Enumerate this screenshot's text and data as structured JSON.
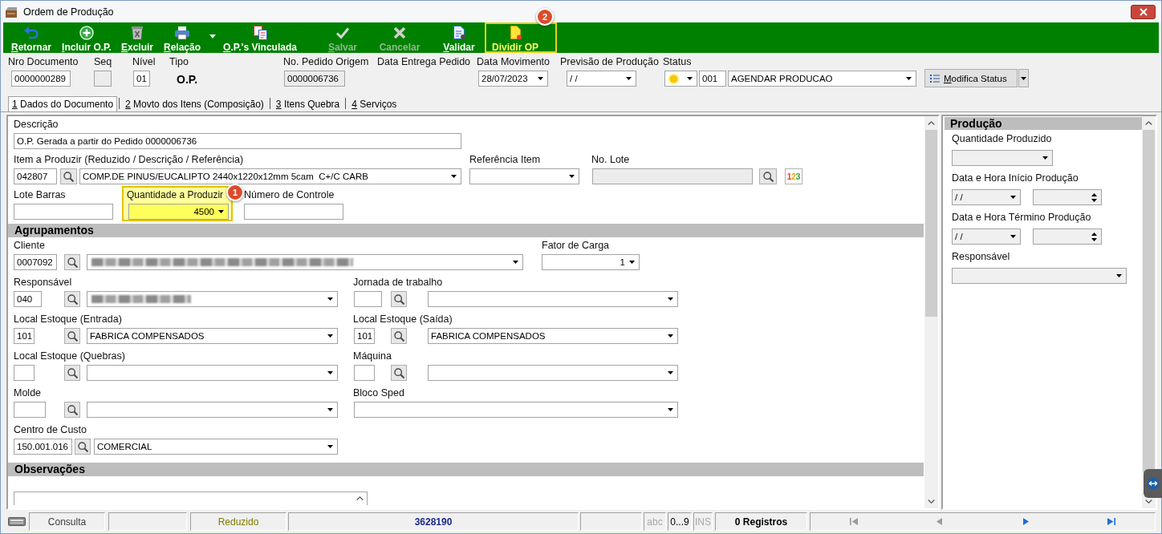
{
  "window": {
    "title": "Ordem de Produção"
  },
  "toolbar": [
    {
      "kind": "button",
      "label": "Retornar",
      "mnemonic": true,
      "disabled": false,
      "highlighted": false
    },
    {
      "kind": "button",
      "label": "Incluir O.P.",
      "mnemonic": true,
      "disabled": false,
      "highlighted": false
    },
    {
      "kind": "button",
      "label": "Excluir",
      "mnemonic": true,
      "disabled": false,
      "highlighted": false
    },
    {
      "kind": "button",
      "label": "Relação",
      "mnemonic": true,
      "disabled": false,
      "highlighted": false
    },
    {
      "kind": "caret",
      "disabled": false,
      "highlighted": false
    },
    {
      "kind": "button",
      "label": "O.P.'s Vinculada",
      "mnemonic": true,
      "disabled": false,
      "highlighted": false
    },
    {
      "kind": "button",
      "label": "Salvar",
      "mnemonic": true,
      "disabled": true,
      "highlighted": false
    },
    {
      "kind": "button",
      "label": "Cancelar",
      "mnemonic": false,
      "disabled": true,
      "highlighted": false
    },
    {
      "kind": "button",
      "label": "Validar",
      "mnemonic": true,
      "disabled": false,
      "highlighted": false
    },
    {
      "kind": "button",
      "label": "Dividir OP",
      "mnemonic": false,
      "disabled": false,
      "highlighted": true,
      "badge": "2"
    }
  ],
  "header": {
    "fields": [
      {
        "label": "Nro Documento",
        "controls": [
          {
            "kind": "field",
            "value": "0000000289"
          }
        ]
      },
      {
        "label": "Seq",
        "controls": [
          {
            "kind": "locked-field"
          }
        ]
      },
      {
        "label": "Nível",
        "controls": [
          {
            "kind": "field",
            "value": "01"
          }
        ]
      },
      {
        "label": "Tipo",
        "controls": [
          {
            "kind": "display",
            "value": "O.P."
          }
        ]
      },
      {
        "label": "No. Pedido Origem",
        "controls": [
          {
            "kind": "locked-field",
            "value": "0000006736"
          }
        ]
      },
      {
        "label": "Data Entrega Pedido"
      },
      {
        "label": "Data Movimento",
        "controls": [
          {
            "kind": "combo",
            "value": "28/07/2023"
          }
        ]
      },
      {
        "label": "Previsão de Produção",
        "controls": [
          {
            "kind": "combo",
            "value": "/ /"
          }
        ]
      },
      {
        "label": "Status",
        "controls": [
          {
            "kind": "color-picker"
          },
          {
            "kind": "field",
            "value": "001"
          },
          {
            "kind": "combo",
            "value": "AGENDAR PRODUCAO"
          },
          {
            "kind": "action",
            "label": "Modifica Status",
            "mnemonic": true
          },
          {
            "kind": "caret-button"
          }
        ]
      }
    ]
  },
  "tabs": [
    {
      "label": "1 Dados do Documento",
      "selected": true,
      "mnemonic": true
    },
    {
      "label": "2 Movto dos Itens (Composição)",
      "selected": false,
      "mnemonic": true
    },
    {
      "label": "3 Itens Quebra",
      "selected": false,
      "mnemonic": true
    },
    {
      "label": "4 Serviços",
      "selected": false,
      "mnemonic": true
    }
  ],
  "form": {
    "sections": [
      {
        "fields": [
          {
            "label": "Descrição",
            "highlighted": false,
            "controls": [
              {
                "kind": "field",
                "value": "O.P. Gerada a partir do Pedido 0000006736"
              }
            ]
          },
          {
            "label": "Item a Produzir (Reduzido / Descrição / Referência)",
            "highlighted": false,
            "controls": [
              {
                "kind": "field",
                "value": "042807"
              },
              {
                "kind": "search"
              },
              {
                "kind": "combo",
                "value": "COMP.DE PINUS/EUCALIPTO 2440x1220x12mm 5cam  C+/C CARB"
              }
            ]
          },
          {
            "label": "Referência Item",
            "highlighted": false,
            "controls": [
              {
                "kind": "combo"
              }
            ]
          },
          {
            "label": "No. Lote",
            "highlighted": false,
            "controls": [
              {
                "kind": "locked-field"
              },
              {
                "kind": "search"
              },
              {
                "kind": "sequence",
                "label": "123"
              }
            ]
          },
          {
            "label": "Lote Barras",
            "highlighted": false,
            "controls": [
              {
                "kind": "field"
              }
            ]
          },
          {
            "label": "Quantidade a Produzir",
            "highlighted": true,
            "badge": "1",
            "controls": [
              {
                "kind": "number-combo",
                "value": "4500"
              }
            ]
          },
          {
            "label": "Número de Controle",
            "highlighted": false,
            "controls": [
              {
                "kind": "field"
              }
            ]
          }
        ]
      },
      {
        "title": "Agrupamentos",
        "fields": [
          {
            "label": "Cliente",
            "highlighted": false,
            "controls": [
              {
                "kind": "field",
                "value": "0007092"
              },
              {
                "kind": "search"
              },
              {
                "kind": "blurred-combo"
              }
            ]
          },
          {
            "label": "Fator de Carga",
            "highlighted": false,
            "controls": [
              {
                "kind": "number-combo",
                "value": "1"
              }
            ]
          },
          {
            "label": "Responsável",
            "highlighted": false,
            "controls": [
              {
                "kind": "field",
                "value": "040"
              },
              {
                "kind": "search"
              },
              {
                "kind": "blurred-combo"
              }
            ]
          },
          {
            "label": "Jornada de trabalho",
            "highlighted": false,
            "controls": [
              {
                "kind": "field"
              },
              {
                "kind": "search"
              },
              {
                "kind": "combo"
              }
            ]
          },
          {
            "label": "Local Estoque (Entrada)",
            "highlighted": false,
            "controls": [
              {
                "kind": "field",
                "value": "101"
              },
              {
                "kind": "search"
              },
              {
                "kind": "combo",
                "value": "FABRICA COMPENSADOS"
              }
            ]
          },
          {
            "label": "Local Estoque (Saída)",
            "highlighted": false,
            "controls": [
              {
                "kind": "field",
                "value": "101"
              },
              {
                "kind": "search"
              },
              {
                "kind": "combo",
                "value": "FABRICA COMPENSADOS"
              }
            ]
          },
          {
            "label": "Local Estoque (Quebras)",
            "highlighted": false,
            "controls": [
              {
                "kind": "field"
              },
              {
                "kind": "search"
              },
              {
                "kind": "combo"
              }
            ]
          },
          {
            "label": "Máquina",
            "highlighted": false,
            "controls": [
              {
                "kind": "field"
              },
              {
                "kind": "search"
              },
              {
                "kind": "combo"
              }
            ]
          },
          {
            "label": "Molde",
            "highlighted": false,
            "controls": [
              {
                "kind": "field"
              },
              {
                "kind": "search"
              },
              {
                "kind": "combo"
              }
            ]
          },
          {
            "label": "Bloco Sped",
            "highlighted": false,
            "controls": [
              {
                "kind": "combo"
              }
            ]
          },
          {
            "label": "Centro de Custo",
            "highlighted": false,
            "controls": [
              {
                "kind": "field",
                "value": "150.001.016"
              },
              {
                "kind": "search"
              },
              {
                "kind": "combo",
                "value": "COMERCIAL"
              }
            ]
          }
        ]
      },
      {
        "title": "Observações",
        "fields": [
          {
            "highlighted": false,
            "controls": [
              {
                "kind": "memo"
              }
            ]
          }
        ]
      }
    ]
  },
  "production": {
    "title": "Produção",
    "groups": [
      {
        "label": "Quantidade Produzido",
        "controls": [
          {
            "kind": "locked-combo"
          }
        ]
      },
      {
        "label": "Data e Hora Início Produção",
        "controls": [
          {
            "kind": "locked-combo",
            "value": "/ /"
          },
          {
            "kind": "spinner"
          }
        ]
      },
      {
        "label": "Data e Hora Término Produção",
        "controls": [
          {
            "kind": "locked-combo",
            "value": "/ /"
          },
          {
            "kind": "spinner"
          }
        ]
      },
      {
        "label": "Responsável",
        "controls": [
          {
            "kind": "locked-combo"
          }
        ]
      }
    ]
  },
  "status_bar": [
    {
      "kind": "keyboard"
    },
    {
      "kind": "label",
      "text": "Consulta"
    },
    {
      "kind": "blank"
    },
    {
      "kind": "mode",
      "text": "Reduzido"
    },
    {
      "kind": "value",
      "text": "3628190"
    },
    {
      "kind": "blank"
    },
    {
      "kind": "indicator",
      "text": "abc",
      "on": false
    },
    {
      "kind": "indicator",
      "text": "0...9",
      "on": true
    },
    {
      "kind": "indicator",
      "text": "INS",
      "on": false
    },
    {
      "kind": "count",
      "text": "0 Registros"
    },
    {
      "kind": "navigator",
      "buttons": [
        {
          "disabled": true
        },
        {
          "disabled": true
        },
        {
          "disabled": false
        },
        {
          "disabled": false
        }
      ]
    }
  ]
}
